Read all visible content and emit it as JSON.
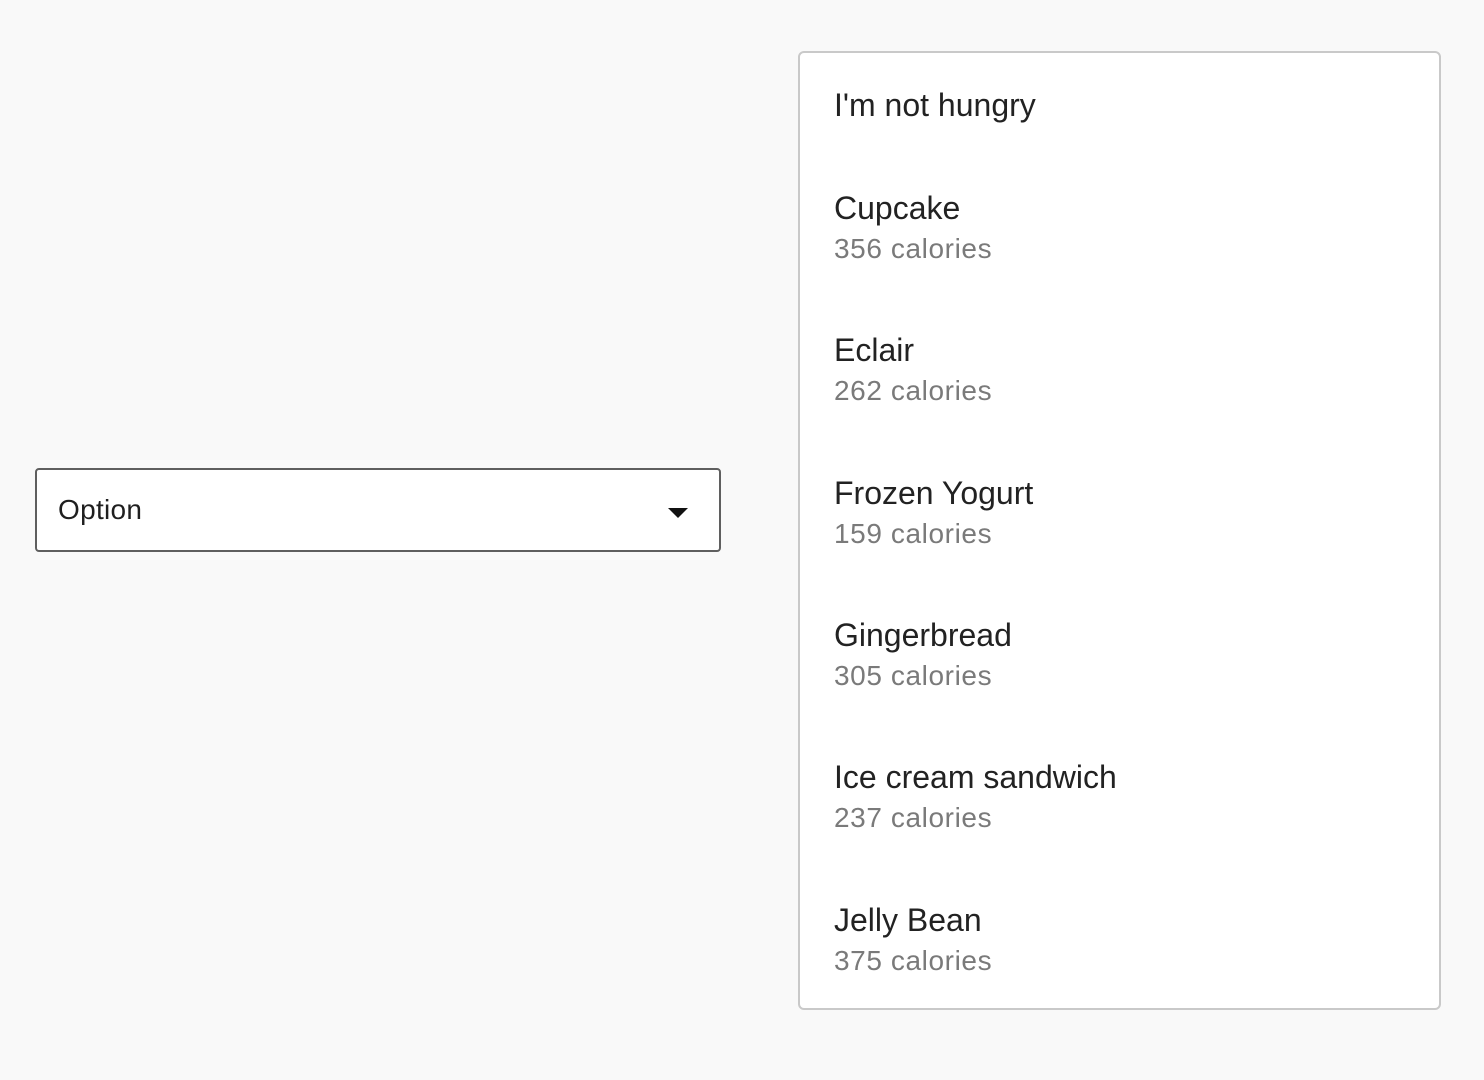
{
  "select": {
    "value": "Option",
    "icon": "arrow-drop-down-icon"
  },
  "menu": {
    "items": [
      {
        "label": "I'm not hungry"
      },
      {
        "label": "Cupcake",
        "sublabel": "356 calories"
      },
      {
        "label": "Eclair",
        "sublabel": "262 calories"
      },
      {
        "label": "Frozen Yogurt",
        "sublabel": "159 calories"
      },
      {
        "label": "Gingerbread",
        "sublabel": "305 calories"
      },
      {
        "label": "Ice cream sandwich",
        "sublabel": "237 calories"
      },
      {
        "label": "Jelly Bean",
        "sublabel": "375 calories"
      }
    ]
  }
}
